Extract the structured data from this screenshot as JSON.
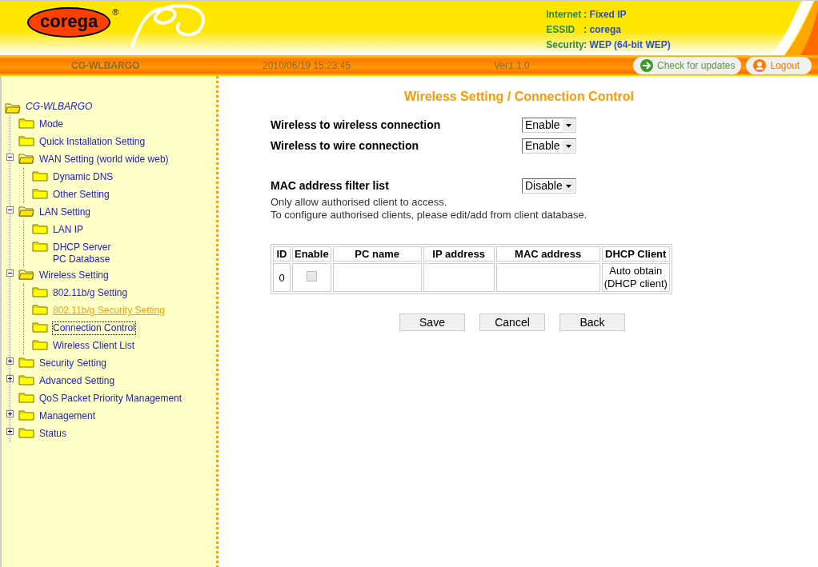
{
  "header": {
    "logo": "corega",
    "registered": "®",
    "info": [
      {
        "label": "Internet",
        "value": ": Fixed IP"
      },
      {
        "label": "ESSID",
        "value": ": corega"
      },
      {
        "label": "Security",
        "value": ": WEP (64-bit WEP)"
      }
    ]
  },
  "status_bar": {
    "device": "CG-WLBARGO",
    "datetime": "2010/06/19 15:23:45",
    "version": "Ver1.1.0",
    "update_button": "Check for updates",
    "logout_button": "Logout"
  },
  "sidebar": {
    "root": "CG-WLBARGO",
    "items": [
      {
        "label": "Mode",
        "expanded": false,
        "selected": false,
        "visited": false
      },
      {
        "label": "Quick Installation Setting",
        "expanded": false,
        "selected": false,
        "visited": false
      },
      {
        "label": "WAN Setting (world wide web)",
        "expanded": true,
        "selected": false,
        "visited": false,
        "children": [
          {
            "label": "Dynamic DNS",
            "selected": false,
            "visited": false
          },
          {
            "label": "Other Setting",
            "selected": false,
            "visited": false
          }
        ]
      },
      {
        "label": "LAN Setting",
        "expanded": true,
        "selected": false,
        "visited": false,
        "children": [
          {
            "label": "LAN IP",
            "selected": false,
            "visited": false
          },
          {
            "label": "DHCP Server\nPC Database",
            "selected": false,
            "visited": false
          }
        ]
      },
      {
        "label": "Wireless Setting",
        "expanded": true,
        "selected": false,
        "visited": false,
        "children": [
          {
            "label": "802.11b/g Setting",
            "selected": false,
            "visited": false
          },
          {
            "label": "802.11b/g Security Setting",
            "selected": false,
            "visited": true
          },
          {
            "label": "Connection Control",
            "selected": true,
            "visited": false
          },
          {
            "label": "Wireless Client List",
            "selected": false,
            "visited": false
          }
        ]
      },
      {
        "label": "Security Setting",
        "expanded": false,
        "has_children": true,
        "selected": false,
        "visited": false
      },
      {
        "label": "Advanced Setting",
        "expanded": false,
        "has_children": true,
        "selected": false,
        "visited": false
      },
      {
        "label": "QoS Packet Priority Management",
        "expanded": false,
        "selected": false,
        "visited": false
      },
      {
        "label": "Management",
        "expanded": false,
        "has_children": true,
        "selected": false,
        "visited": false
      },
      {
        "label": "Status",
        "expanded": false,
        "has_children": true,
        "selected": false,
        "visited": false
      }
    ]
  },
  "page": {
    "title": "Wireless Setting / Connection Control",
    "settings": [
      {
        "label": "Wireless to wireless connection",
        "value": "Enable"
      },
      {
        "label": "Wireless to wire connection",
        "value": "Enable"
      }
    ],
    "mac_filter": {
      "label": "MAC address filter list",
      "value": "Disable"
    },
    "notes": [
      "Only allow authorised client to access.",
      "To configure authorised clients, please edit/add from client database."
    ],
    "table": {
      "columns": [
        "ID",
        "Enable",
        "PC name",
        "IP address",
        "MAC address",
        "DHCP Client"
      ],
      "rows": [
        {
          "id": "0",
          "enabled": false,
          "disabled": true,
          "dhcp": "Auto obtain\n(DHCP client)"
        }
      ]
    },
    "buttons": [
      "Save",
      "Cancel",
      "Back"
    ]
  }
}
